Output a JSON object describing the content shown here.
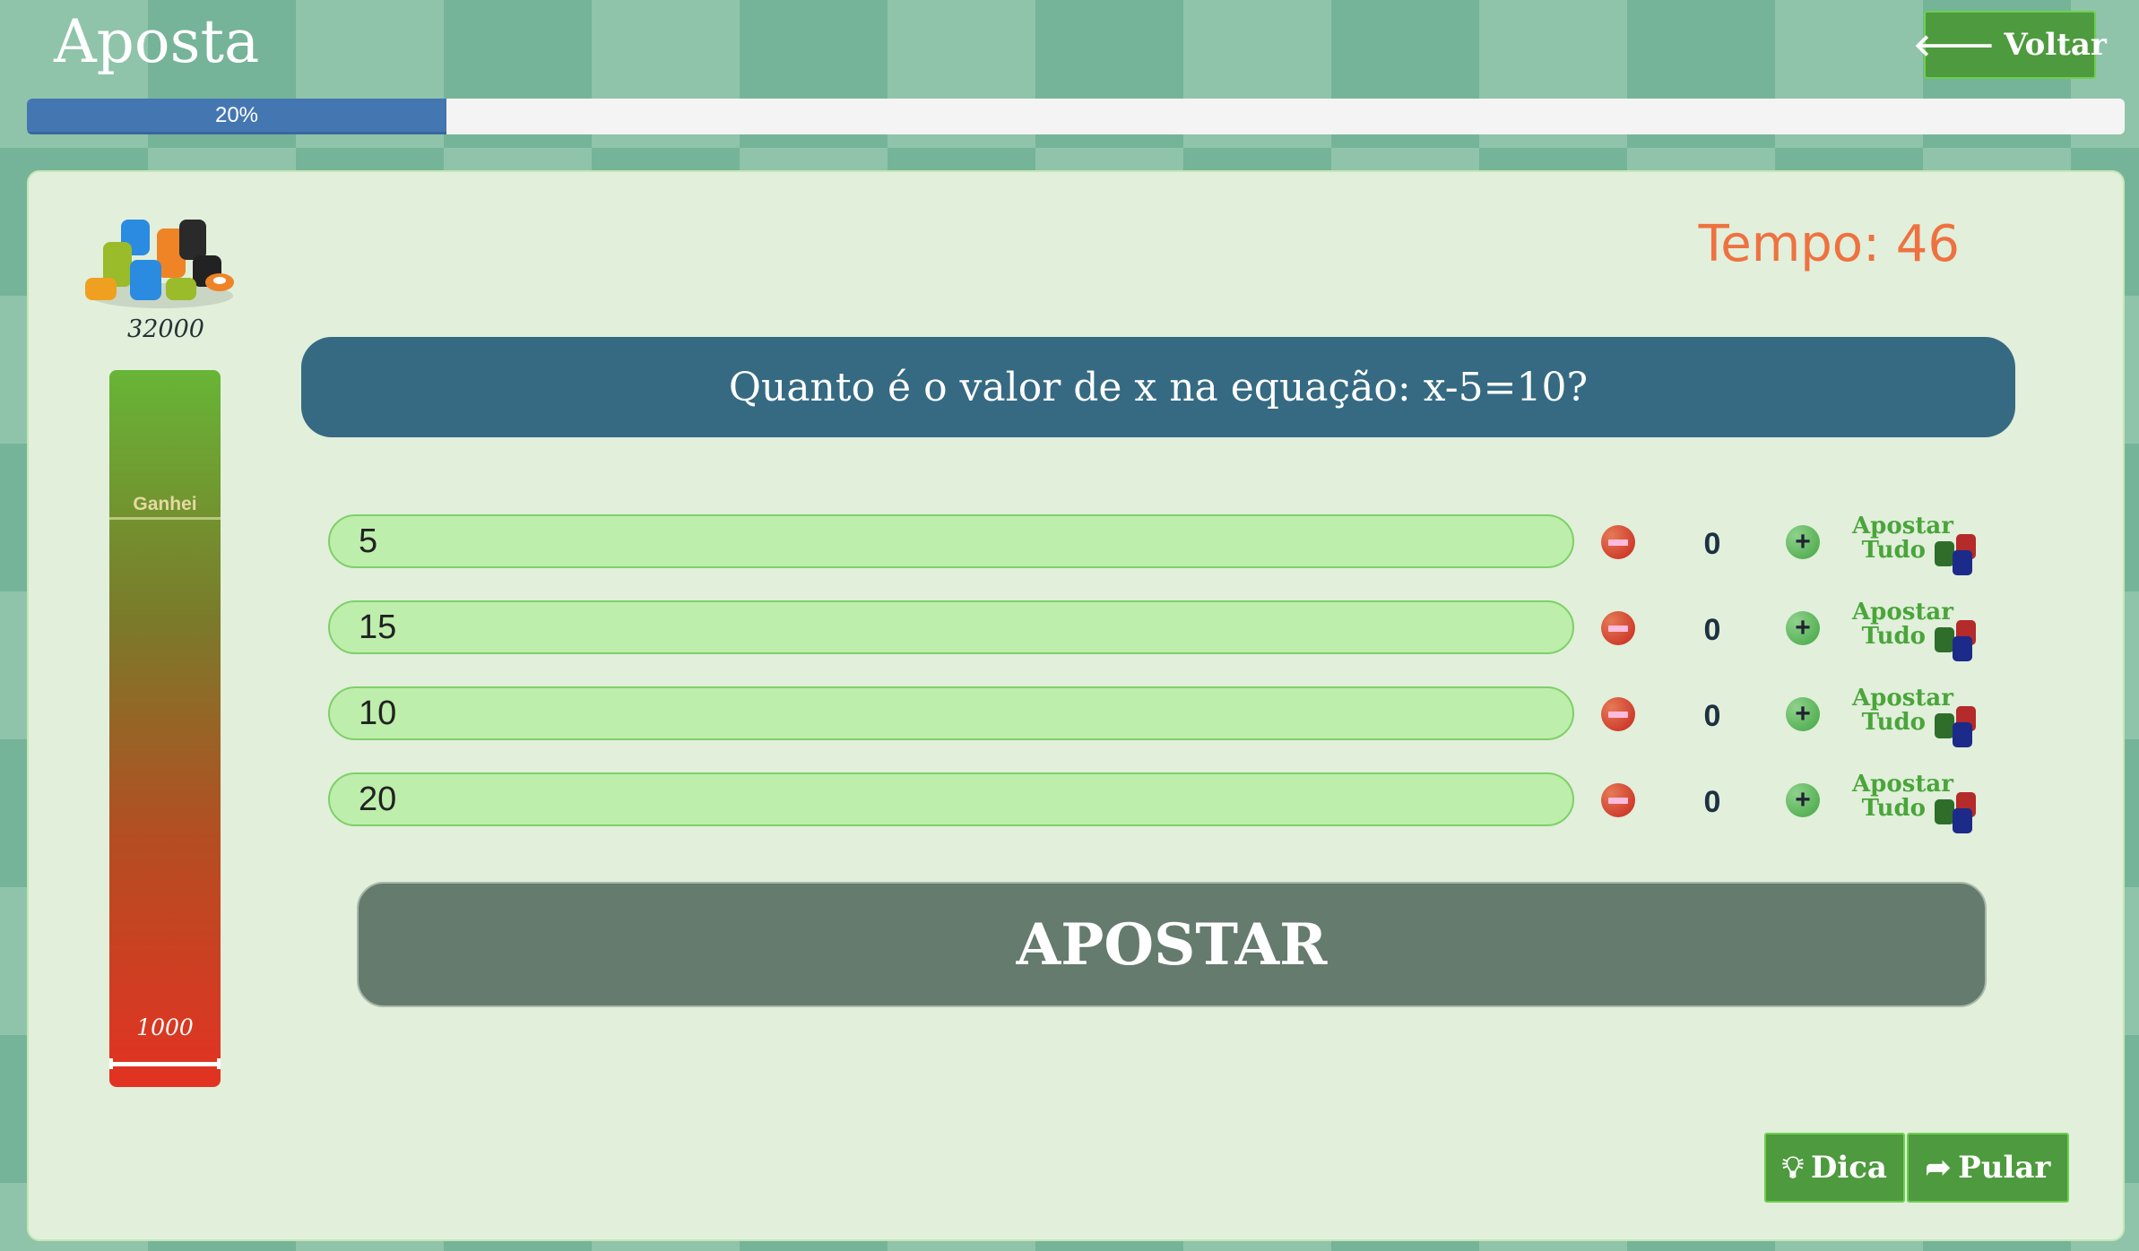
{
  "header": {
    "title": "Aposta",
    "back_label": "Voltar",
    "back_icon": "arrow-left-icon"
  },
  "progress": {
    "percent": 20,
    "label": "20%"
  },
  "player": {
    "balance": "32000",
    "won_label": "Ganhei",
    "min_label": "1000"
  },
  "timer": {
    "label": "Tempo: 46"
  },
  "question": "Quanto é o valor de x na equação: x-5=10?",
  "answers": [
    {
      "text": "5",
      "bet": "0"
    },
    {
      "text": "15",
      "bet": "0"
    },
    {
      "text": "10",
      "bet": "0"
    },
    {
      "text": "20",
      "bet": "0"
    }
  ],
  "controls": {
    "minus": "−",
    "plus": "+",
    "bet_all_line1": "Apostar",
    "bet_all_line2": "Tudo"
  },
  "bet_button": "APOSTAR",
  "footer": {
    "hint_label": "Dica",
    "skip_label": "Pular"
  },
  "colors": {
    "accent": "#4e9a3e",
    "question_bg": "#356a82",
    "timer": "#ee7240",
    "progress": "#4477b2"
  }
}
